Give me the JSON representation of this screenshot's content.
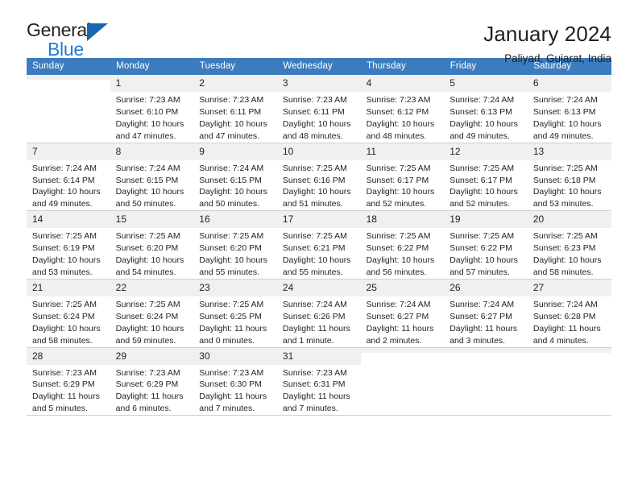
{
  "brand": {
    "name_part1": "General",
    "name_part2": "Blue",
    "color_dark": "#231f20",
    "color_blue": "#1d7fd1",
    "triangle_color": "#1666b0",
    "triangle_icon": "triangle-icon"
  },
  "header": {
    "title": "January 2024",
    "subtitle": "Paliyad, Gujarat, India"
  },
  "theme": {
    "header_row_bg": "#3c7cbe",
    "header_row_text": "#ffffff",
    "daynum_bg": "#f0f0f0",
    "grid_line": "#cfcfcf"
  },
  "weekday_headers": [
    "Sunday",
    "Monday",
    "Tuesday",
    "Wednesday",
    "Thursday",
    "Friday",
    "Saturday"
  ],
  "labels": {
    "sunrise_prefix": "Sunrise:",
    "sunset_prefix": "Sunset:",
    "daylight_prefix": "Daylight:"
  },
  "weeks": [
    [
      {
        "day": "",
        "line1": "",
        "line2": "",
        "line3": "",
        "line4": ""
      },
      {
        "day": "1",
        "line1": "Sunrise: 7:23 AM",
        "line2": "Sunset: 6:10 PM",
        "line3": "Daylight: 10 hours",
        "line4": "and 47 minutes."
      },
      {
        "day": "2",
        "line1": "Sunrise: 7:23 AM",
        "line2": "Sunset: 6:11 PM",
        "line3": "Daylight: 10 hours",
        "line4": "and 47 minutes."
      },
      {
        "day": "3",
        "line1": "Sunrise: 7:23 AM",
        "line2": "Sunset: 6:11 PM",
        "line3": "Daylight: 10 hours",
        "line4": "and 48 minutes."
      },
      {
        "day": "4",
        "line1": "Sunrise: 7:23 AM",
        "line2": "Sunset: 6:12 PM",
        "line3": "Daylight: 10 hours",
        "line4": "and 48 minutes."
      },
      {
        "day": "5",
        "line1": "Sunrise: 7:24 AM",
        "line2": "Sunset: 6:13 PM",
        "line3": "Daylight: 10 hours",
        "line4": "and 49 minutes."
      },
      {
        "day": "6",
        "line1": "Sunrise: 7:24 AM",
        "line2": "Sunset: 6:13 PM",
        "line3": "Daylight: 10 hours",
        "line4": "and 49 minutes."
      }
    ],
    [
      {
        "day": "7",
        "line1": "Sunrise: 7:24 AM",
        "line2": "Sunset: 6:14 PM",
        "line3": "Daylight: 10 hours",
        "line4": "and 49 minutes."
      },
      {
        "day": "8",
        "line1": "Sunrise: 7:24 AM",
        "line2": "Sunset: 6:15 PM",
        "line3": "Daylight: 10 hours",
        "line4": "and 50 minutes."
      },
      {
        "day": "9",
        "line1": "Sunrise: 7:24 AM",
        "line2": "Sunset: 6:15 PM",
        "line3": "Daylight: 10 hours",
        "line4": "and 50 minutes."
      },
      {
        "day": "10",
        "line1": "Sunrise: 7:25 AM",
        "line2": "Sunset: 6:16 PM",
        "line3": "Daylight: 10 hours",
        "line4": "and 51 minutes."
      },
      {
        "day": "11",
        "line1": "Sunrise: 7:25 AM",
        "line2": "Sunset: 6:17 PM",
        "line3": "Daylight: 10 hours",
        "line4": "and 52 minutes."
      },
      {
        "day": "12",
        "line1": "Sunrise: 7:25 AM",
        "line2": "Sunset: 6:17 PM",
        "line3": "Daylight: 10 hours",
        "line4": "and 52 minutes."
      },
      {
        "day": "13",
        "line1": "Sunrise: 7:25 AM",
        "line2": "Sunset: 6:18 PM",
        "line3": "Daylight: 10 hours",
        "line4": "and 53 minutes."
      }
    ],
    [
      {
        "day": "14",
        "line1": "Sunrise: 7:25 AM",
        "line2": "Sunset: 6:19 PM",
        "line3": "Daylight: 10 hours",
        "line4": "and 53 minutes."
      },
      {
        "day": "15",
        "line1": "Sunrise: 7:25 AM",
        "line2": "Sunset: 6:20 PM",
        "line3": "Daylight: 10 hours",
        "line4": "and 54 minutes."
      },
      {
        "day": "16",
        "line1": "Sunrise: 7:25 AM",
        "line2": "Sunset: 6:20 PM",
        "line3": "Daylight: 10 hours",
        "line4": "and 55 minutes."
      },
      {
        "day": "17",
        "line1": "Sunrise: 7:25 AM",
        "line2": "Sunset: 6:21 PM",
        "line3": "Daylight: 10 hours",
        "line4": "and 55 minutes."
      },
      {
        "day": "18",
        "line1": "Sunrise: 7:25 AM",
        "line2": "Sunset: 6:22 PM",
        "line3": "Daylight: 10 hours",
        "line4": "and 56 minutes."
      },
      {
        "day": "19",
        "line1": "Sunrise: 7:25 AM",
        "line2": "Sunset: 6:22 PM",
        "line3": "Daylight: 10 hours",
        "line4": "and 57 minutes."
      },
      {
        "day": "20",
        "line1": "Sunrise: 7:25 AM",
        "line2": "Sunset: 6:23 PM",
        "line3": "Daylight: 10 hours",
        "line4": "and 58 minutes."
      }
    ],
    [
      {
        "day": "21",
        "line1": "Sunrise: 7:25 AM",
        "line2": "Sunset: 6:24 PM",
        "line3": "Daylight: 10 hours",
        "line4": "and 58 minutes."
      },
      {
        "day": "22",
        "line1": "Sunrise: 7:25 AM",
        "line2": "Sunset: 6:24 PM",
        "line3": "Daylight: 10 hours",
        "line4": "and 59 minutes."
      },
      {
        "day": "23",
        "line1": "Sunrise: 7:25 AM",
        "line2": "Sunset: 6:25 PM",
        "line3": "Daylight: 11 hours",
        "line4": "and 0 minutes."
      },
      {
        "day": "24",
        "line1": "Sunrise: 7:24 AM",
        "line2": "Sunset: 6:26 PM",
        "line3": "Daylight: 11 hours",
        "line4": "and 1 minute."
      },
      {
        "day": "25",
        "line1": "Sunrise: 7:24 AM",
        "line2": "Sunset: 6:27 PM",
        "line3": "Daylight: 11 hours",
        "line4": "and 2 minutes."
      },
      {
        "day": "26",
        "line1": "Sunrise: 7:24 AM",
        "line2": "Sunset: 6:27 PM",
        "line3": "Daylight: 11 hours",
        "line4": "and 3 minutes."
      },
      {
        "day": "27",
        "line1": "Sunrise: 7:24 AM",
        "line2": "Sunset: 6:28 PM",
        "line3": "Daylight: 11 hours",
        "line4": "and 4 minutes."
      }
    ],
    [
      {
        "day": "28",
        "line1": "Sunrise: 7:23 AM",
        "line2": "Sunset: 6:29 PM",
        "line3": "Daylight: 11 hours",
        "line4": "and 5 minutes."
      },
      {
        "day": "29",
        "line1": "Sunrise: 7:23 AM",
        "line2": "Sunset: 6:29 PM",
        "line3": "Daylight: 11 hours",
        "line4": "and 6 minutes."
      },
      {
        "day": "30",
        "line1": "Sunrise: 7:23 AM",
        "line2": "Sunset: 6:30 PM",
        "line3": "Daylight: 11 hours",
        "line4": "and 7 minutes."
      },
      {
        "day": "31",
        "line1": "Sunrise: 7:23 AM",
        "line2": "Sunset: 6:31 PM",
        "line3": "Daylight: 11 hours",
        "line4": "and 7 minutes."
      },
      {
        "day": "",
        "line1": "",
        "line2": "",
        "line3": "",
        "line4": ""
      },
      {
        "day": "",
        "line1": "",
        "line2": "",
        "line3": "",
        "line4": ""
      },
      {
        "day": "",
        "line1": "",
        "line2": "",
        "line3": "",
        "line4": ""
      }
    ]
  ]
}
